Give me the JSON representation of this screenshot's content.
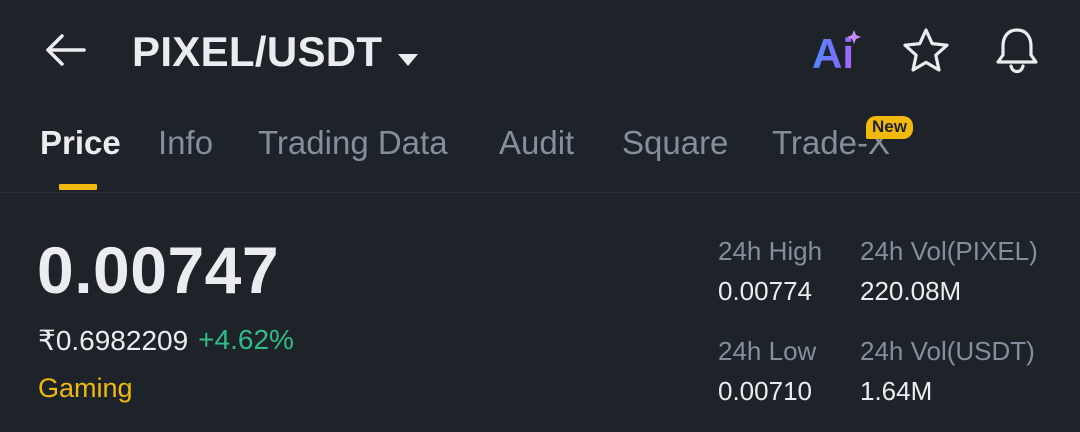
{
  "header": {
    "pair": "PIXEL/USDT",
    "icons": {
      "back": "arrow-left-icon",
      "dropdown": "caret-down-icon",
      "ai": "ai-icon",
      "favorite": "star-icon",
      "alerts": "bell-icon"
    },
    "ai_label": "Ai"
  },
  "tabs": [
    {
      "label": "Price",
      "active": true
    },
    {
      "label": "Info",
      "active": false
    },
    {
      "label": "Trading Data",
      "active": false
    },
    {
      "label": "Audit",
      "active": false
    },
    {
      "label": "Square",
      "active": false
    },
    {
      "label": "Trade-X",
      "active": false,
      "badge": "New"
    }
  ],
  "ticker": {
    "last_price": "0.00747",
    "fiat_price": "₹0.6982209",
    "change_pct": "+4.62%",
    "category": "Gaming"
  },
  "stats": {
    "high_label": "24h High",
    "high_value": "0.00774",
    "low_label": "24h Low",
    "low_value": "0.00710",
    "vol_base_label": "24h Vol(PIXEL)",
    "vol_base_value": "220.08M",
    "vol_quote_label": "24h Vol(USDT)",
    "vol_quote_value": "1.64M"
  },
  "colors": {
    "background": "#1e2329",
    "accent": "#f0b90b",
    "positive": "#2ebd85",
    "muted": "#848e9c",
    "text": "#eaecef"
  }
}
